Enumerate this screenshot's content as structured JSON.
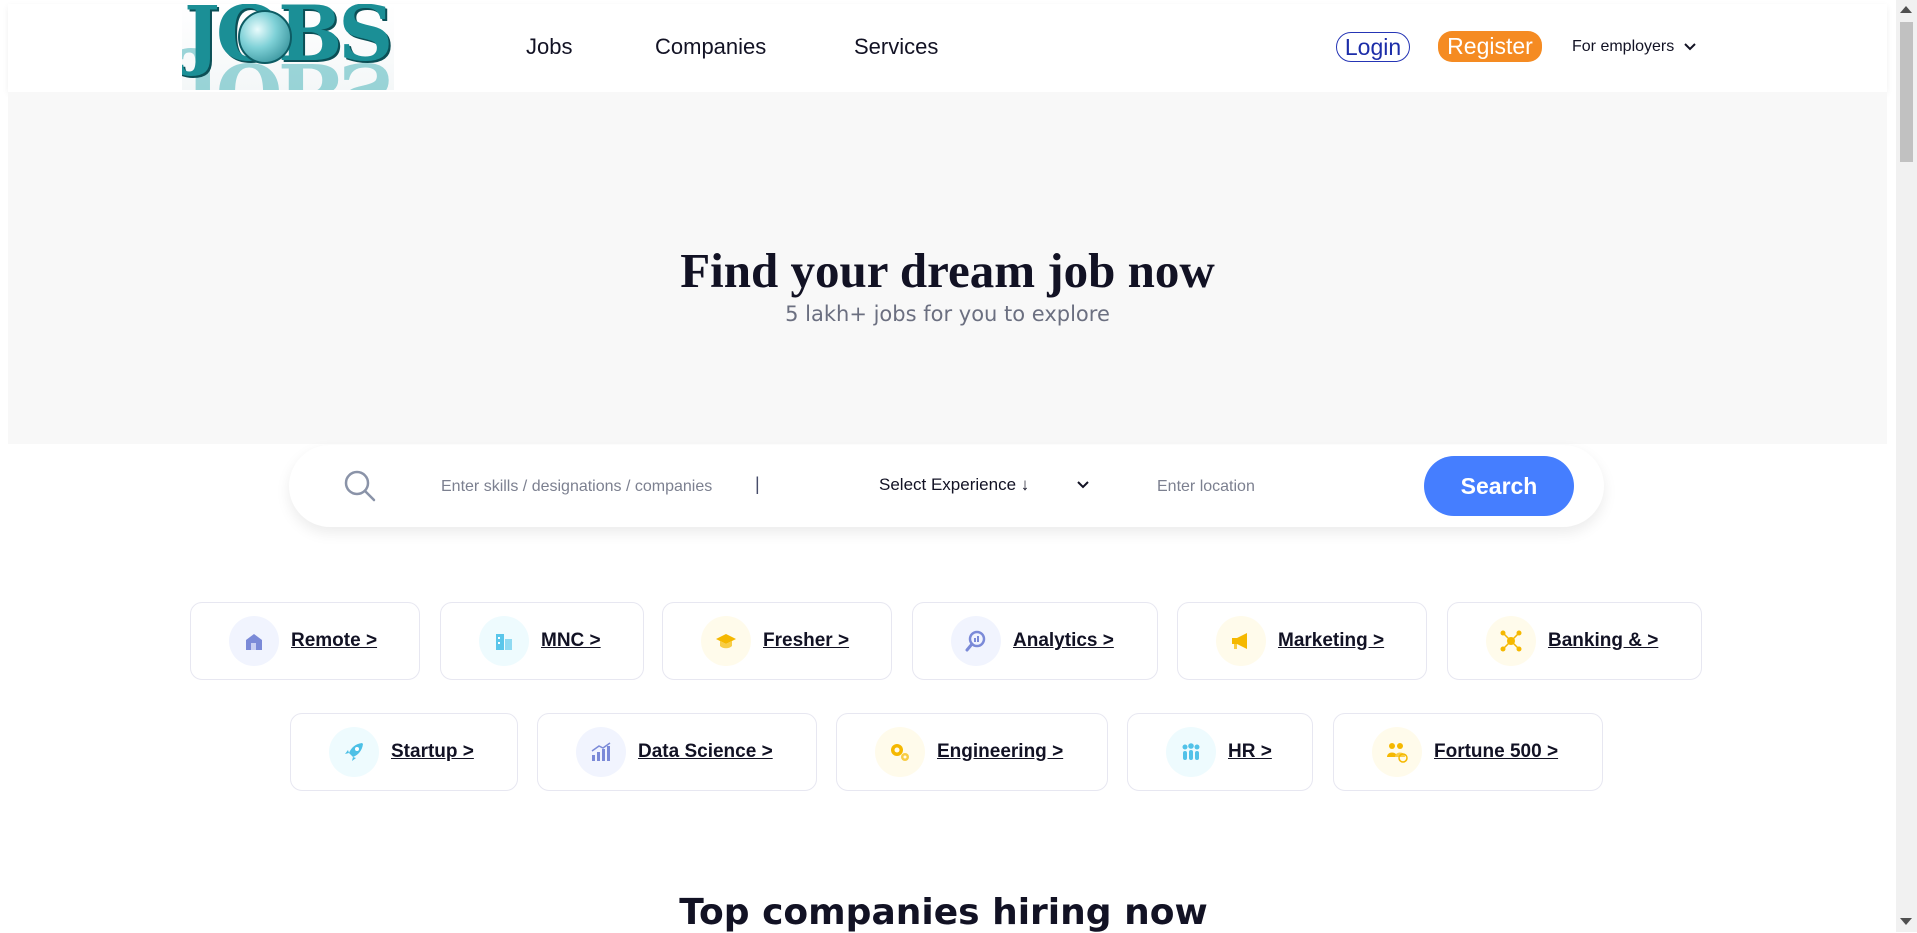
{
  "header": {
    "logo_text": "JOBS",
    "nav": [
      "Jobs",
      "Companies",
      "Services"
    ],
    "login_label": "Login",
    "register_label": "Register",
    "employers_label": "For employers"
  },
  "hero": {
    "title": "Find your dream job now",
    "subtitle": "5 lakh+ jobs for you to explore"
  },
  "search": {
    "skills_placeholder": "Enter skills / designations / companies",
    "divider": "|",
    "experience_label": "Select Experience ↓",
    "location_placeholder": "Enter location",
    "button_label": "Search"
  },
  "categories": [
    {
      "label": "Remote >",
      "icon": "home-office-icon",
      "color": "#6b7bd6"
    },
    {
      "label": "MNC >",
      "icon": "buildings-icon",
      "color": "#52c2e8"
    },
    {
      "label": "Fresher >",
      "icon": "graduation-cap-icon",
      "color": "#f5b800"
    },
    {
      "label": "Analytics >",
      "icon": "magnifier-chart-icon",
      "color": "#6b7bd6"
    },
    {
      "label": "Marketing >",
      "icon": "megaphone-icon",
      "color": "#f5b800"
    },
    {
      "label": "Banking & >",
      "icon": "network-nodes-icon",
      "color": "#f5b800"
    },
    {
      "label": "Startup >",
      "icon": "rocket-icon",
      "color": "#52c2e8"
    },
    {
      "label": "Data Science >",
      "icon": "growth-chart-icon",
      "color": "#6b7bd6"
    },
    {
      "label": "Engineering >",
      "icon": "gears-icon",
      "color": "#f5b800"
    },
    {
      "label": "HR >",
      "icon": "people-icon",
      "color": "#52c2e8"
    },
    {
      "label": "Fortune 500 >",
      "icon": "team-globe-icon",
      "color": "#f5b800"
    }
  ],
  "section": {
    "title": "Top companies hiring now"
  },
  "colors": {
    "accent_blue": "#457eff",
    "register_orange": "#f58b22",
    "login_blue": "#1c2da8"
  }
}
